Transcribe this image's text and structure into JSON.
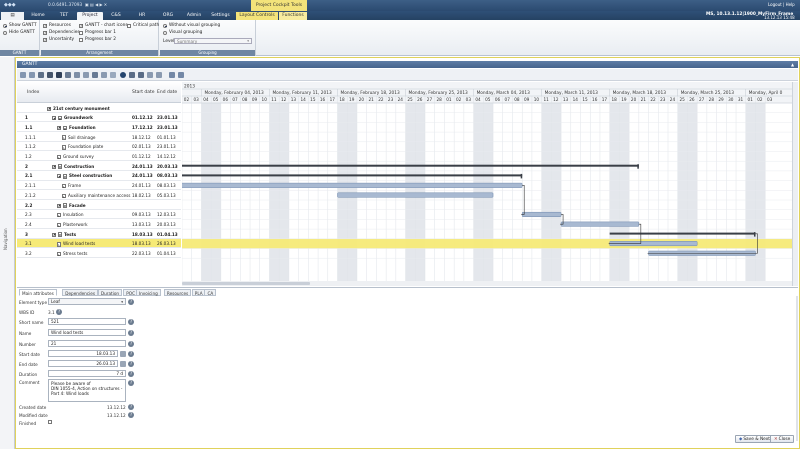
{
  "window": {
    "app_version": "0.0.6491.37093",
    "context_tab_title": "Project Cockpit Tools",
    "user_links": "Logout | Help",
    "server": "MS, 10.13.1.12|1900_MyFirm_Frame",
    "date": "13.12.13 15:48"
  },
  "tabs": [
    "Home",
    "TET",
    "Project",
    "C&S",
    "HR",
    "ORG",
    "Admin",
    "Settings",
    "Layout Controls",
    "Functions"
  ],
  "ribbon": {
    "gantt_group": {
      "label": "GANTT",
      "show": "Show GANTT",
      "hide": "Hide GANTT"
    },
    "arrangement_group": {
      "label": "Arrangement",
      "resources": "Resources",
      "dependencies": "Dependencies",
      "uncertainty": "Uncertainty",
      "chart_icons": "GANTT - chart icons",
      "progress1": "Progress bar 1",
      "progress2": "Progress bar 2",
      "critical": "Critical path"
    },
    "grouping_group": {
      "label": "Grouping",
      "without": "Without visual grouping",
      "visual": "Visual grouping",
      "level_label": "Level",
      "level_value": "Summary"
    }
  },
  "sidebar_label": "Navigation",
  "panel": {
    "title": "GANTT"
  },
  "table": {
    "headers": {
      "index": "Index",
      "start": "Start date",
      "end": "End date"
    },
    "rows": [
      {
        "index": "",
        "name": "21st century monument",
        "start": "",
        "end": "",
        "level": 0,
        "bold": true,
        "kind": "root"
      },
      {
        "index": "1",
        "name": "Groundwork",
        "start": "01.12.12",
        "end": "23.01.13",
        "level": 1,
        "bold": true,
        "kind": "group"
      },
      {
        "index": "1.1",
        "name": "Foundation",
        "start": "17.12.12",
        "end": "23.01.13",
        "level": 2,
        "bold": true,
        "kind": "group"
      },
      {
        "index": "1.1.1",
        "name": "Soil drainage",
        "start": "18.12.12",
        "end": "01.01.13",
        "level": 3,
        "bold": false,
        "kind": "leaf"
      },
      {
        "index": "1.1.2",
        "name": "Foundation plate",
        "start": "02.01.13",
        "end": "23.01.13",
        "level": 3,
        "bold": false,
        "kind": "leaf"
      },
      {
        "index": "1.2",
        "name": "Ground survey",
        "start": "01.12.12",
        "end": "14.12.12",
        "level": 2,
        "bold": false,
        "kind": "leaf"
      },
      {
        "index": "2",
        "name": "Construction",
        "start": "24.01.13",
        "end": "20.03.13",
        "level": 1,
        "bold": true,
        "kind": "group"
      },
      {
        "index": "2.1",
        "name": "Steel construction",
        "start": "24.01.13",
        "end": "08.03.13",
        "level": 2,
        "bold": true,
        "kind": "group"
      },
      {
        "index": "2.1.1",
        "name": "Frame",
        "start": "24.01.13",
        "end": "08.03.13",
        "level": 3,
        "bold": false,
        "kind": "leaf"
      },
      {
        "index": "2.1.2",
        "name": "Auxiliary maintenance access",
        "start": "18.02.13",
        "end": "05.03.13",
        "level": 3,
        "bold": false,
        "kind": "leaf"
      },
      {
        "index": "2.2",
        "name": "Facade",
        "start": "",
        "end": "",
        "level": 2,
        "bold": true,
        "kind": "group"
      },
      {
        "index": "2.3",
        "name": "Insulation",
        "start": "09.03.13",
        "end": "12.03.13",
        "level": 2,
        "bold": false,
        "kind": "leaf"
      },
      {
        "index": "2.4",
        "name": "Plasterwork",
        "start": "13.03.13",
        "end": "20.03.13",
        "level": 2,
        "bold": false,
        "kind": "leaf"
      },
      {
        "index": "3",
        "name": "Tests",
        "start": "18.03.13",
        "end": "01.04.13",
        "level": 1,
        "bold": true,
        "kind": "group"
      },
      {
        "index": "3.1",
        "name": "Wind load tests",
        "start": "18.03.13",
        "end": "26.03.13",
        "level": 2,
        "bold": false,
        "kind": "leaf",
        "selected": true
      },
      {
        "index": "3.2",
        "name": "Stress tests",
        "start": "22.03.13",
        "end": "01.04.13",
        "level": 2,
        "bold": false,
        "kind": "leaf"
      }
    ]
  },
  "timeline": {
    "year_label": "2013",
    "weeks": [
      "Monday, February 04, 2013",
      "Monday, February 11, 2013",
      "Monday, February 18, 2013",
      "Monday, February 25, 2013",
      "Monday, March 04, 2013",
      "Monday, March 11, 2013",
      "Monday, March 18, 2013",
      "Monday, March 25, 2013",
      "Monday, April 0"
    ],
    "days": [
      "02",
      "03",
      "04",
      "05",
      "06",
      "07",
      "08",
      "09",
      "10",
      "11",
      "12",
      "13",
      "14",
      "15",
      "16",
      "17",
      "18",
      "19",
      "20",
      "21",
      "22",
      "23",
      "24",
      "25",
      "26",
      "27",
      "28",
      "01",
      "02",
      "03",
      "04",
      "05",
      "06",
      "07",
      "08",
      "09",
      "10",
      "11",
      "12",
      "13",
      "14",
      "15",
      "16",
      "17",
      "18",
      "19",
      "20",
      "21",
      "22",
      "23",
      "24",
      "25",
      "26",
      "27",
      "28",
      "29",
      "30",
      "31",
      "01",
      "02",
      "03"
    ]
  },
  "details": {
    "tabs": [
      "Main attributes",
      "Dependencies",
      "Duration",
      "POC",
      "Invoicing",
      "Resources",
      "PLA",
      "CA"
    ],
    "element_type": {
      "label": "Element type",
      "value": "Leaf"
    },
    "wbs_id": {
      "label": "WBS ID",
      "value": "3.1"
    },
    "short_name": {
      "label": "Short name",
      "value": "521"
    },
    "name": {
      "label": "Name",
      "value": "Wind load tests"
    },
    "number": {
      "label": "Number",
      "value": "21"
    },
    "start_date": {
      "label": "Start date",
      "value": "18.03.13"
    },
    "end_date": {
      "label": "End date",
      "value": "26.03.13"
    },
    "duration": {
      "label": "Duration",
      "value": "7 d"
    },
    "comment": {
      "label": "Comment",
      "line1": "Please be aware of",
      "line2": "DIN 1055-4, Action on structures -",
      "line3": "Part 4: Wind loads"
    },
    "created": {
      "label": "Created date",
      "value": "13.12.12"
    },
    "modified": {
      "label": "Modified date",
      "value": "13.12.12"
    },
    "finished": {
      "label": "Finished"
    }
  },
  "footer": {
    "save_next": "Save & Next",
    "close": "Close"
  }
}
